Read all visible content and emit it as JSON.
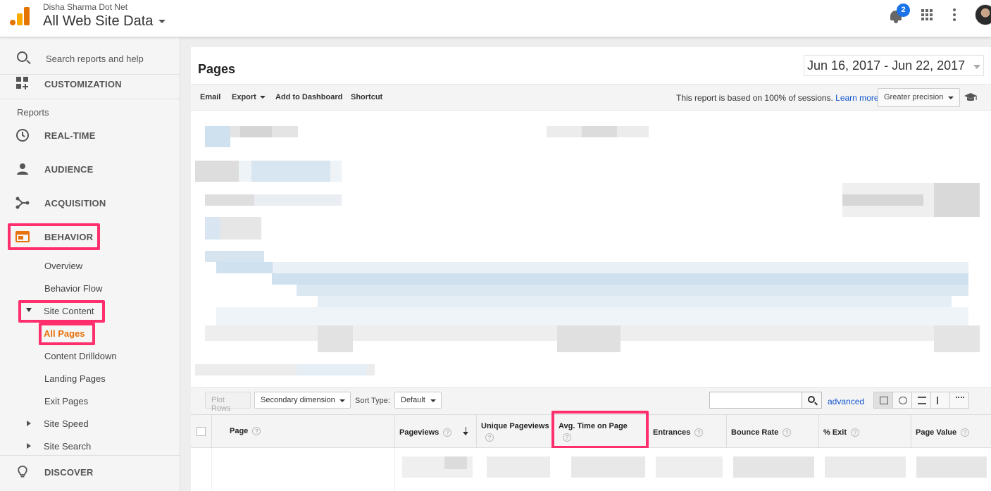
{
  "header": {
    "account": "Disha Sharma Dot Net",
    "property": "All Web Site Data",
    "notifications_count": "2"
  },
  "sidebar": {
    "search_placeholder": "Search reports and help",
    "customization": "CUSTOMIZATION",
    "reports_label": "Reports",
    "realtime": "REAL-TIME",
    "audience": "AUDIENCE",
    "acquisition": "ACQUISITION",
    "behavior": "BEHAVIOR",
    "behavior_items": {
      "overview": "Overview",
      "behavior_flow": "Behavior Flow",
      "site_content": "Site Content",
      "all_pages": "All Pages",
      "content_drilldown": "Content Drilldown",
      "landing_pages": "Landing Pages",
      "exit_pages": "Exit Pages",
      "site_speed": "Site Speed",
      "site_search": "Site Search"
    },
    "discover": "DISCOVER"
  },
  "report": {
    "title": "Pages",
    "date_range": "Jun 16, 2017 - Jun 22, 2017",
    "toolbar": {
      "email": "Email",
      "export": "Export",
      "add_to_dashboard": "Add to Dashboard",
      "shortcut": "Shortcut",
      "notice": "This report is based on 100% of sessions.",
      "learn_more": "Learn more",
      "precision": "Greater precision"
    },
    "controls": {
      "plot_rows": "Plot Rows",
      "secondary_dimension": "Secondary dimension",
      "sort_type_label": "Sort Type:",
      "sort_type_value": "Default",
      "advanced": "advanced"
    },
    "columns": {
      "page": "Page",
      "pageviews": "Pageviews",
      "unique_pageviews": "Unique Pageviews",
      "avg_time_on_page": "Avg. Time on Page",
      "entrances": "Entrances",
      "bounce_rate": "Bounce Rate",
      "exit": "% Exit",
      "page_value": "Page Value"
    },
    "help_glyph": "?"
  },
  "colors": {
    "highlight": "#ff2f6d",
    "active_nav": "#e8710a",
    "link": "#1155cc",
    "badge": "#1a73e8"
  }
}
